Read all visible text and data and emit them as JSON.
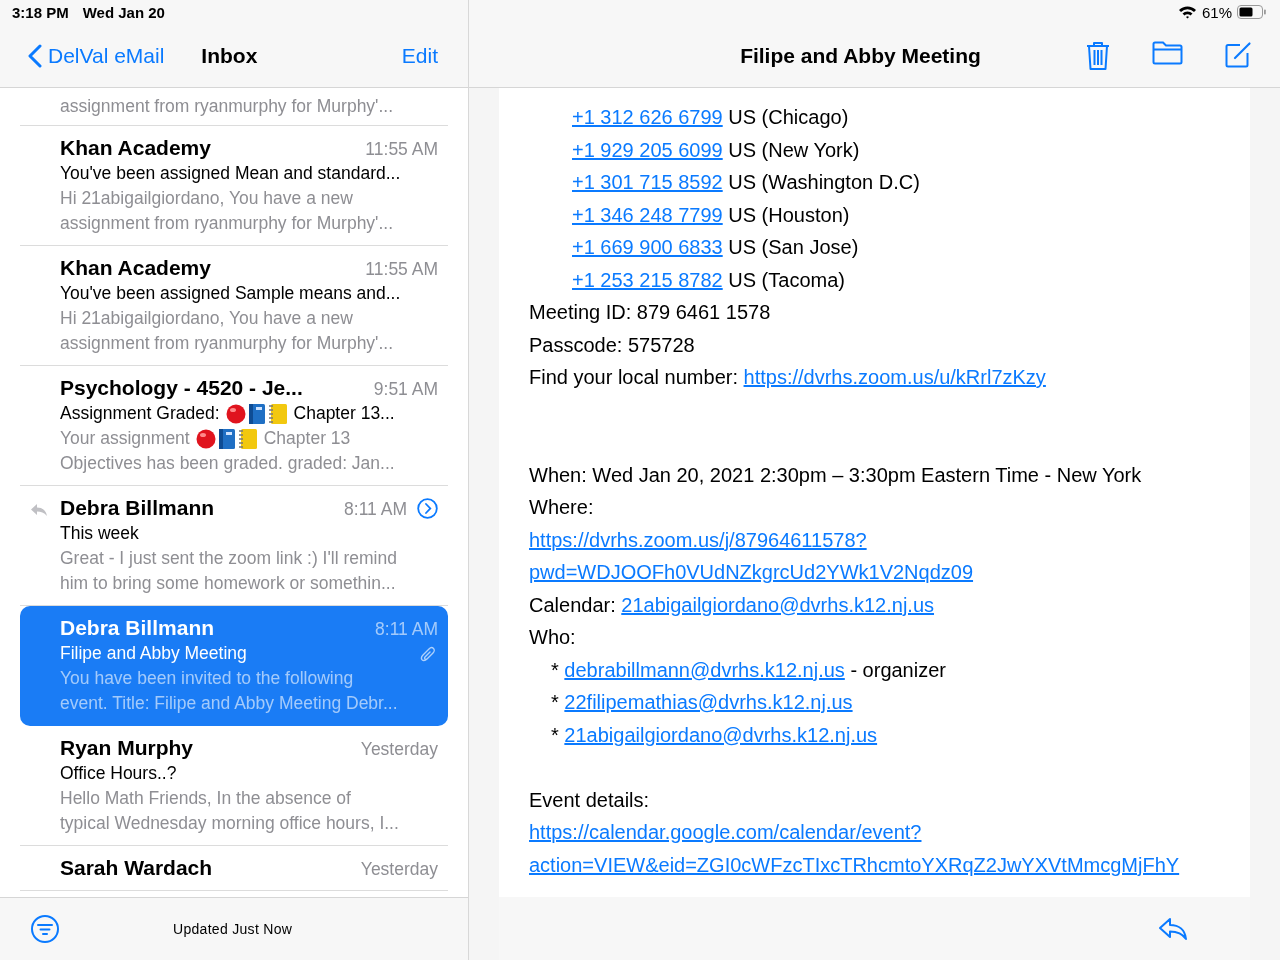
{
  "status_bar": {
    "time": "3:18 PM",
    "date": "Wed Jan 20",
    "battery": "61%"
  },
  "mailbox_header": {
    "back": "DelVal eMail",
    "title": "Inbox",
    "edit": "Edit"
  },
  "messages": [
    {
      "selected": false,
      "preview": [
        {
          "text": "assignment from ryanmurphy for Murphy'..."
        }
      ]
    },
    {
      "selected": false,
      "sender": "Khan Academy",
      "time": "11:55 AM",
      "subject": {
        "text": "You've been assigned Mean and standard..."
      },
      "preview": [
        {
          "text": "Hi 21abigailgiordano, You have a new"
        },
        {
          "text": "assignment from ryanmurphy for Murphy'..."
        }
      ]
    },
    {
      "selected": false,
      "sender": "Khan Academy",
      "time": "11:55 AM",
      "subject": {
        "text": "You've been assigned Sample means and..."
      },
      "preview": [
        {
          "text": "Hi 21abigailgiordano, You have a new"
        },
        {
          "text": "assignment from ryanmurphy for Murphy'..."
        }
      ]
    },
    {
      "selected": false,
      "sender": "Psychology - 4520 - Je...",
      "time": "9:51 AM",
      "subject": {
        "text": "Assignment Graded:",
        "tail": "Chapter 13..."
      },
      "preview": [
        {
          "text": "Your assignment",
          "tail": "Chapter 13"
        },
        {
          "text": "Objectives has been graded. graded: Jan..."
        }
      ]
    },
    {
      "selected": false,
      "replied": true,
      "thread": true,
      "sender": "Debra Billmann",
      "time": "8:11 AM",
      "subject": {
        "text": "This week"
      },
      "preview": [
        {
          "text": "Great - I just sent the zoom link :) I'll remind"
        },
        {
          "text": "him to bring some homework or somethin..."
        }
      ]
    },
    {
      "selected": true,
      "attachment": true,
      "sender": "Debra Billmann",
      "time": "8:11 AM",
      "subject": {
        "text": "Filipe and Abby Meeting"
      },
      "preview": [
        {
          "text": "You have been invited to the following"
        },
        {
          "text": "event. Title: Filipe and Abby Meeting Debr..."
        }
      ]
    },
    {
      "selected": false,
      "sender": "Ryan Murphy",
      "time": "Yesterday",
      "subject": {
        "text": "Office Hours..?"
      },
      "preview": [
        {
          "text": "Hello Math Friends, In the absence of"
        },
        {
          "text": "typical Wednesday morning office hours, I..."
        }
      ]
    },
    {
      "selected": false,
      "sender": "Sarah Wardach",
      "time": "Yesterday"
    }
  ],
  "mailbox_footer": {
    "status": "Updated Just Now"
  },
  "message_header": {
    "title": "Filipe and Abby Meeting"
  },
  "body": [
    {
      "kind": "indent",
      "parts": [
        {
          "text": "+1 312 626 6799",
          "link": true
        },
        {
          "text": "US (Chicago)",
          "link": false
        }
      ]
    },
    {
      "kind": "indent",
      "parts": [
        {
          "text": "+1 929 205 6099",
          "link": true
        },
        {
          "text": "US (New York)",
          "link": false
        }
      ]
    },
    {
      "kind": "indent",
      "parts": [
        {
          "text": "+1 301 715 8592",
          "link": true
        },
        {
          "text": "US (Washington D.C)",
          "link": false
        }
      ]
    },
    {
      "kind": "indent",
      "parts": [
        {
          "text": "+1 346 248 7799",
          "link": true
        },
        {
          "text": "US (Houston)",
          "link": false
        }
      ]
    },
    {
      "kind": "indent",
      "parts": [
        {
          "text": "+1 669 900 6833",
          "link": true
        },
        {
          "text": "US (San Jose)",
          "link": false
        }
      ]
    },
    {
      "kind": "indent",
      "parts": [
        {
          "text": "+1 253 215 8782",
          "link": true
        },
        {
          "text": "US (Tacoma)",
          "link": false
        }
      ]
    },
    {
      "kind": "plain",
      "parts": [
        {
          "text": "Meeting ID: 879 6461 1578",
          "link": false
        }
      ]
    },
    {
      "kind": "plain",
      "parts": [
        {
          "text": "Passcode: 575728",
          "link": false
        }
      ]
    },
    {
      "kind": "plain",
      "parts": [
        {
          "text": "Find your local number:",
          "link": false
        },
        {
          "text": "https://dvrhs.zoom.us/u/kRrl7zKzy",
          "link": true
        }
      ]
    },
    {
      "kind": "blank"
    },
    {
      "kind": "blank"
    },
    {
      "kind": "plain",
      "parts": [
        {
          "text": "When: Wed Jan 20, 2021 2:30pm – 3:30pm Eastern Time - New York",
          "link": false
        }
      ]
    },
    {
      "kind": "plain",
      "parts": [
        {
          "text": "Where:",
          "link": false
        }
      ]
    },
    {
      "kind": "plain",
      "parts": [
        {
          "text": "https://dvrhs.zoom.us/j/87964611578?",
          "link": true
        }
      ]
    },
    {
      "kind": "plain",
      "parts": [
        {
          "text": "pwd=WDJOOFh0VUdNZkgrcUd2YWk1V2Nqdz09",
          "link": true
        }
      ]
    },
    {
      "kind": "plain",
      "parts": [
        {
          "text": "Calendar:",
          "link": false
        },
        {
          "text": "21abigailgiordano@dvrhs.k12.nj.us",
          "link": true
        }
      ]
    },
    {
      "kind": "plain",
      "parts": [
        {
          "text": "Who:",
          "link": false
        }
      ]
    },
    {
      "kind": "bullet",
      "parts": [
        {
          "text": "*",
          "link": false
        },
        {
          "text": "debrabillmann@dvrhs.k12.nj.us",
          "link": true
        },
        {
          "text": "- organizer",
          "link": false
        }
      ]
    },
    {
      "kind": "bullet",
      "parts": [
        {
          "text": "*",
          "link": false
        },
        {
          "text": "22filipemathias@dvrhs.k12.nj.us",
          "link": true
        }
      ]
    },
    {
      "kind": "bullet",
      "parts": [
        {
          "text": "*",
          "link": false
        },
        {
          "text": "21abigailgiordano@dvrhs.k12.nj.us",
          "link": true
        }
      ]
    },
    {
      "kind": "blank"
    },
    {
      "kind": "plain",
      "parts": [
        {
          "text": "Event details:",
          "link": false
        }
      ]
    },
    {
      "kind": "plain",
      "parts": [
        {
          "text": "https://calendar.google.com/calendar/event?",
          "link": true
        }
      ]
    },
    {
      "kind": "plain",
      "parts": [
        {
          "text": "action=VIEW&eid=ZGI0cWFzcTIxcTRhcmtoYXRqZ2JwYXVtMmcgMjFhY",
          "link": true
        }
      ]
    }
  ]
}
